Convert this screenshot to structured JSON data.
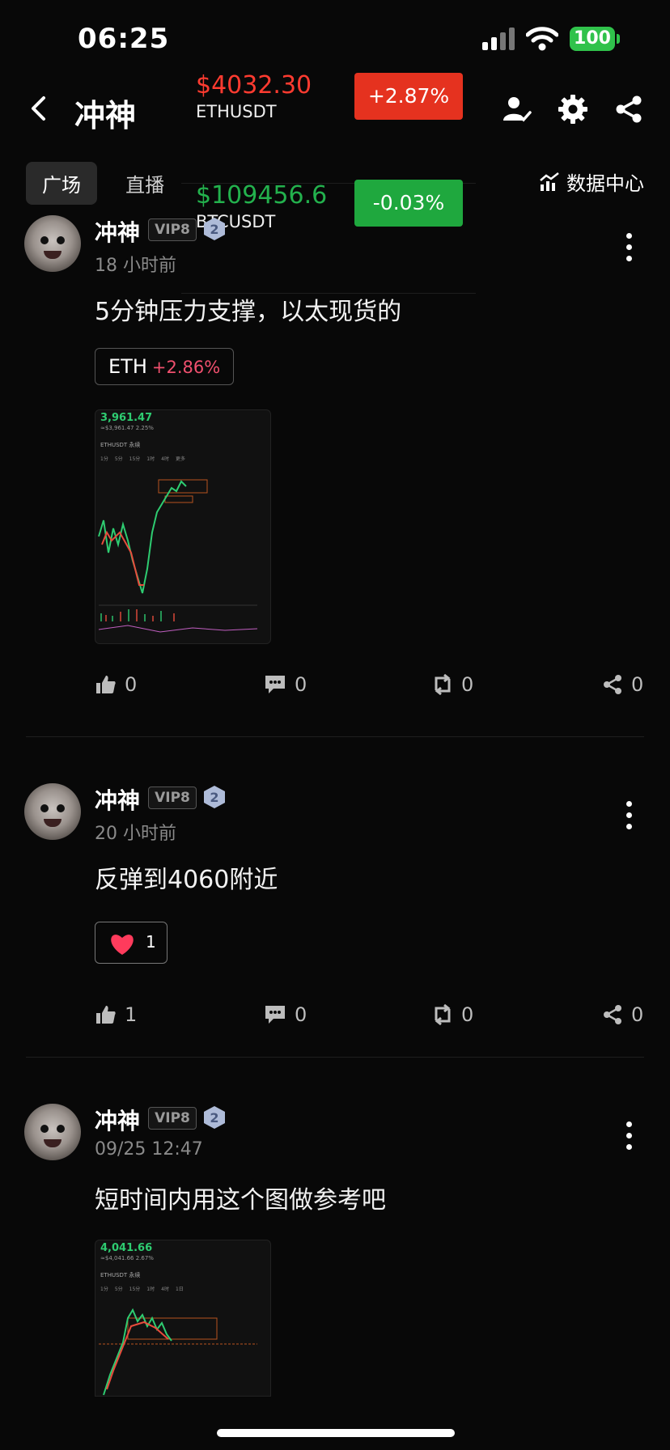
{
  "status_bar": {
    "time": "06:25",
    "battery": "100"
  },
  "header": {
    "title": "冲神",
    "back_icon": "chevron-left-icon",
    "icons": [
      "user-follow-icon",
      "gear-icon",
      "share-icon"
    ]
  },
  "tabs": [
    {
      "label": "广场",
      "active": true
    },
    {
      "label": "直播",
      "active": false
    }
  ],
  "data_center": {
    "label": "数据中心",
    "icon": "chart-icon"
  },
  "tickers": [
    {
      "price": "$4032.30",
      "symbol": "ETHUSDT",
      "change": "+2.87%",
      "direction": "up",
      "price_color": "#ff3b30",
      "badge_color": "#e5321f"
    },
    {
      "price": "$109456.6",
      "symbol": "BTCUSDT",
      "change": "-0.03%",
      "direction": "down",
      "price_color": "#23b14d",
      "badge_color": "#1fa83e"
    }
  ],
  "posts": [
    {
      "author": "冲神",
      "vip": "VIP8",
      "level": "2",
      "time": "18 小时前",
      "content": "5分钟压力支撑，以太现货的",
      "coin_tag": {
        "symbol": "ETH",
        "change": "+2.86%"
      },
      "chart_preview": {
        "price": "3,961.47",
        "sub": "≈$3,961.47 2.25%",
        "pair": "ETHUSDT 永续",
        "tabs": [
          "1分",
          "5分",
          "15分",
          "1时",
          "4时",
          "更多"
        ]
      },
      "actions": {
        "likes": "0",
        "comments": "0",
        "reposts": "0",
        "shares": "0"
      }
    },
    {
      "author": "冲神",
      "vip": "VIP8",
      "level": "2",
      "time": "20 小时前",
      "content": "反弹到4060附近",
      "reaction": {
        "icon": "heart-icon",
        "count": "1"
      },
      "actions": {
        "likes": "1",
        "comments": "0",
        "reposts": "0",
        "shares": "0"
      }
    },
    {
      "author": "冲神",
      "vip": "VIP8",
      "level": "2",
      "time": "09/25 12:47",
      "content": "短时间内用这个图做参考吧",
      "chart_preview": {
        "price": "4,041.66",
        "sub": "≈$4,041.66 2.67%",
        "pair": "ETHUSDT 永续",
        "tabs": [
          "1分",
          "5分",
          "15分",
          "1时",
          "4时",
          "1日"
        ]
      }
    }
  ]
}
